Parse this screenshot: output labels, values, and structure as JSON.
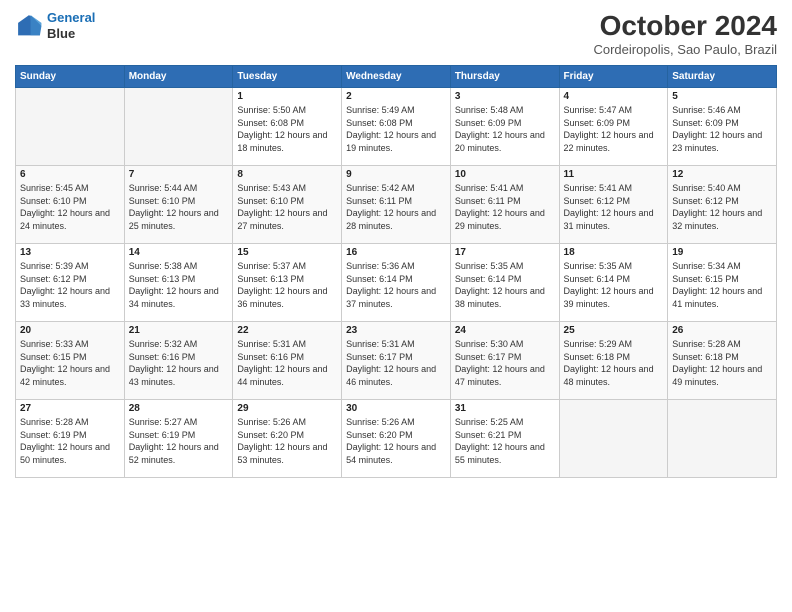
{
  "header": {
    "logo": {
      "line1": "General",
      "line2": "Blue"
    },
    "title": "October 2024",
    "location": "Cordeiropolis, Sao Paulo, Brazil"
  },
  "days_of_week": [
    "Sunday",
    "Monday",
    "Tuesday",
    "Wednesday",
    "Thursday",
    "Friday",
    "Saturday"
  ],
  "weeks": [
    [
      {
        "day": "",
        "empty": true
      },
      {
        "day": "",
        "empty": true
      },
      {
        "day": "1",
        "sunrise": "Sunrise: 5:50 AM",
        "sunset": "Sunset: 6:08 PM",
        "daylight": "Daylight: 12 hours and 18 minutes."
      },
      {
        "day": "2",
        "sunrise": "Sunrise: 5:49 AM",
        "sunset": "Sunset: 6:08 PM",
        "daylight": "Daylight: 12 hours and 19 minutes."
      },
      {
        "day": "3",
        "sunrise": "Sunrise: 5:48 AM",
        "sunset": "Sunset: 6:09 PM",
        "daylight": "Daylight: 12 hours and 20 minutes."
      },
      {
        "day": "4",
        "sunrise": "Sunrise: 5:47 AM",
        "sunset": "Sunset: 6:09 PM",
        "daylight": "Daylight: 12 hours and 22 minutes."
      },
      {
        "day": "5",
        "sunrise": "Sunrise: 5:46 AM",
        "sunset": "Sunset: 6:09 PM",
        "daylight": "Daylight: 12 hours and 23 minutes."
      }
    ],
    [
      {
        "day": "6",
        "sunrise": "Sunrise: 5:45 AM",
        "sunset": "Sunset: 6:10 PM",
        "daylight": "Daylight: 12 hours and 24 minutes."
      },
      {
        "day": "7",
        "sunrise": "Sunrise: 5:44 AM",
        "sunset": "Sunset: 6:10 PM",
        "daylight": "Daylight: 12 hours and 25 minutes."
      },
      {
        "day": "8",
        "sunrise": "Sunrise: 5:43 AM",
        "sunset": "Sunset: 6:10 PM",
        "daylight": "Daylight: 12 hours and 27 minutes."
      },
      {
        "day": "9",
        "sunrise": "Sunrise: 5:42 AM",
        "sunset": "Sunset: 6:11 PM",
        "daylight": "Daylight: 12 hours and 28 minutes."
      },
      {
        "day": "10",
        "sunrise": "Sunrise: 5:41 AM",
        "sunset": "Sunset: 6:11 PM",
        "daylight": "Daylight: 12 hours and 29 minutes."
      },
      {
        "day": "11",
        "sunrise": "Sunrise: 5:41 AM",
        "sunset": "Sunset: 6:12 PM",
        "daylight": "Daylight: 12 hours and 31 minutes."
      },
      {
        "day": "12",
        "sunrise": "Sunrise: 5:40 AM",
        "sunset": "Sunset: 6:12 PM",
        "daylight": "Daylight: 12 hours and 32 minutes."
      }
    ],
    [
      {
        "day": "13",
        "sunrise": "Sunrise: 5:39 AM",
        "sunset": "Sunset: 6:12 PM",
        "daylight": "Daylight: 12 hours and 33 minutes."
      },
      {
        "day": "14",
        "sunrise": "Sunrise: 5:38 AM",
        "sunset": "Sunset: 6:13 PM",
        "daylight": "Daylight: 12 hours and 34 minutes."
      },
      {
        "day": "15",
        "sunrise": "Sunrise: 5:37 AM",
        "sunset": "Sunset: 6:13 PM",
        "daylight": "Daylight: 12 hours and 36 minutes."
      },
      {
        "day": "16",
        "sunrise": "Sunrise: 5:36 AM",
        "sunset": "Sunset: 6:14 PM",
        "daylight": "Daylight: 12 hours and 37 minutes."
      },
      {
        "day": "17",
        "sunrise": "Sunrise: 5:35 AM",
        "sunset": "Sunset: 6:14 PM",
        "daylight": "Daylight: 12 hours and 38 minutes."
      },
      {
        "day": "18",
        "sunrise": "Sunrise: 5:35 AM",
        "sunset": "Sunset: 6:14 PM",
        "daylight": "Daylight: 12 hours and 39 minutes."
      },
      {
        "day": "19",
        "sunrise": "Sunrise: 5:34 AM",
        "sunset": "Sunset: 6:15 PM",
        "daylight": "Daylight: 12 hours and 41 minutes."
      }
    ],
    [
      {
        "day": "20",
        "sunrise": "Sunrise: 5:33 AM",
        "sunset": "Sunset: 6:15 PM",
        "daylight": "Daylight: 12 hours and 42 minutes."
      },
      {
        "day": "21",
        "sunrise": "Sunrise: 5:32 AM",
        "sunset": "Sunset: 6:16 PM",
        "daylight": "Daylight: 12 hours and 43 minutes."
      },
      {
        "day": "22",
        "sunrise": "Sunrise: 5:31 AM",
        "sunset": "Sunset: 6:16 PM",
        "daylight": "Daylight: 12 hours and 44 minutes."
      },
      {
        "day": "23",
        "sunrise": "Sunrise: 5:31 AM",
        "sunset": "Sunset: 6:17 PM",
        "daylight": "Daylight: 12 hours and 46 minutes."
      },
      {
        "day": "24",
        "sunrise": "Sunrise: 5:30 AM",
        "sunset": "Sunset: 6:17 PM",
        "daylight": "Daylight: 12 hours and 47 minutes."
      },
      {
        "day": "25",
        "sunrise": "Sunrise: 5:29 AM",
        "sunset": "Sunset: 6:18 PM",
        "daylight": "Daylight: 12 hours and 48 minutes."
      },
      {
        "day": "26",
        "sunrise": "Sunrise: 5:28 AM",
        "sunset": "Sunset: 6:18 PM",
        "daylight": "Daylight: 12 hours and 49 minutes."
      }
    ],
    [
      {
        "day": "27",
        "sunrise": "Sunrise: 5:28 AM",
        "sunset": "Sunset: 6:19 PM",
        "daylight": "Daylight: 12 hours and 50 minutes."
      },
      {
        "day": "28",
        "sunrise": "Sunrise: 5:27 AM",
        "sunset": "Sunset: 6:19 PM",
        "daylight": "Daylight: 12 hours and 52 minutes."
      },
      {
        "day": "29",
        "sunrise": "Sunrise: 5:26 AM",
        "sunset": "Sunset: 6:20 PM",
        "daylight": "Daylight: 12 hours and 53 minutes."
      },
      {
        "day": "30",
        "sunrise": "Sunrise: 5:26 AM",
        "sunset": "Sunset: 6:20 PM",
        "daylight": "Daylight: 12 hours and 54 minutes."
      },
      {
        "day": "31",
        "sunrise": "Sunrise: 5:25 AM",
        "sunset": "Sunset: 6:21 PM",
        "daylight": "Daylight: 12 hours and 55 minutes."
      },
      {
        "day": "",
        "empty": true
      },
      {
        "day": "",
        "empty": true
      }
    ]
  ]
}
